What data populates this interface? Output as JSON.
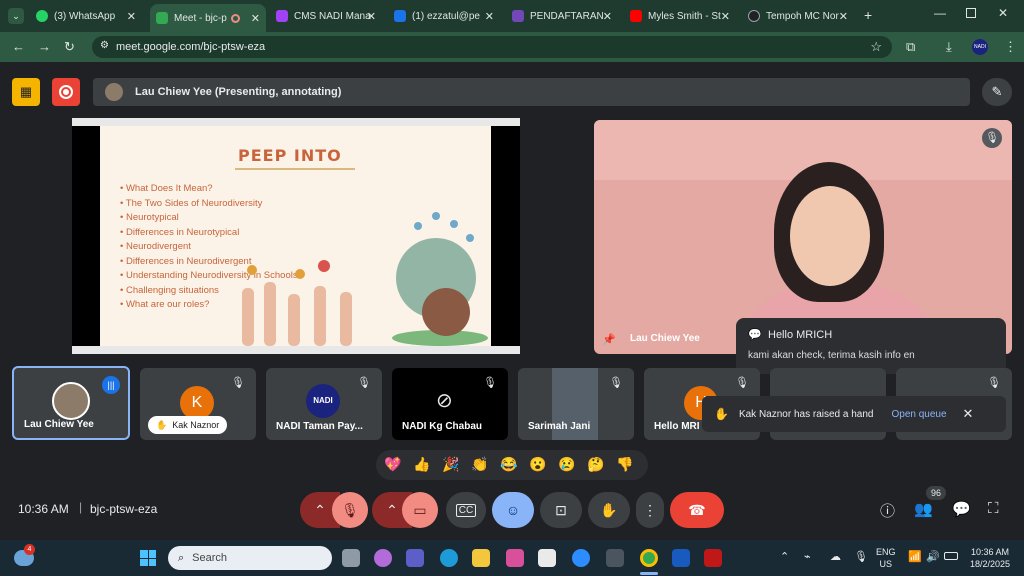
{
  "browser": {
    "tabs": [
      {
        "label": "(3) WhatsApp",
        "color": "#25d366"
      },
      {
        "label": "Meet - bjc-p",
        "color": "#34a853",
        "active": true
      },
      {
        "label": "CMS NADI Mana",
        "color": "#a142f4"
      },
      {
        "label": "(1) ezzatul@pe",
        "color": "#1a73e8"
      },
      {
        "label": "PENDAFTARAN",
        "color": "#7248b9"
      },
      {
        "label": "Myles Smith - St",
        "color": "#ff0000"
      },
      {
        "label": "Tempoh MC Nor",
        "color": "#202124"
      }
    ],
    "url": "meet.google.com/bjc-ptsw-eza",
    "profile": "NADI"
  },
  "meet": {
    "presenter_label": "Lau Chiew Yee (Presenting, annotating)",
    "slide": {
      "title": "PEEP INTO",
      "bullets": [
        "What Does It Mean?",
        "The Two Sides of Neurodiversity",
        "Neurotypical",
        "Differences in Neurotypical",
        "Neurodivergent",
        "Differences in Neurodivergent",
        "Understanding Neurodiversity in Schools",
        "Challenging situations",
        "What are our roles?"
      ]
    },
    "speaker_name": "Lau Chiew Yee",
    "chat_popup": {
      "sender": "Hello MRICH",
      "message": "kami akan check, terima kasih info en"
    },
    "raise_hand": {
      "text": "Kak Naznor has raised a hand",
      "action": "Open queue"
    },
    "participants": [
      {
        "name": "Lau Chiew Yee",
        "type": "photo"
      },
      {
        "name": "Kak Naznor",
        "type": "initial",
        "initial": "K",
        "color": "#e8710a"
      },
      {
        "name": "NADI Taman Pay...",
        "type": "logo",
        "logo": "NADI"
      },
      {
        "name": "NADI Kg Chabau",
        "type": "camoff"
      },
      {
        "name": "Sarimah Jani",
        "type": "photo"
      },
      {
        "name": "Hello MRI",
        "type": "initial",
        "initial": "H",
        "color": "#e8710a"
      }
    ],
    "reactions": [
      "💖",
      "👍",
      "🎉",
      "👏",
      "😂",
      "😮",
      "😢",
      "🤔",
      "👎"
    ],
    "time": "10:36 AM",
    "meeting_code": "bjc-ptsw-eza",
    "participant_count": "96"
  },
  "taskbar": {
    "search_placeholder": "Search",
    "lang": "ENG",
    "region": "US",
    "clock_time": "10:36 AM",
    "clock_date": "18/2/2025",
    "weather_badge": "4"
  }
}
